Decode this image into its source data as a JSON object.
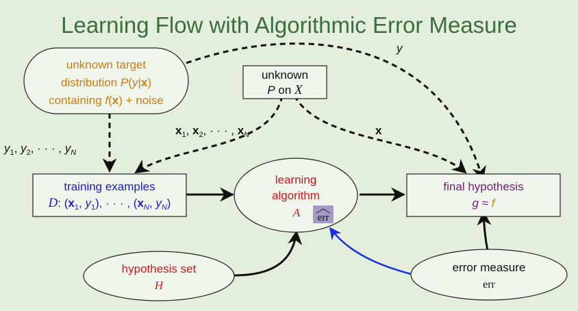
{
  "title": "Learning Flow with Algorithmic Error Measure",
  "colors": {
    "title": "#3c6e3c",
    "orange": "#d07a10",
    "blue": "#1a1ad0",
    "red": "#d01818",
    "purple": "#7a1a7a",
    "err_box": "#a59ac6",
    "blue_arrow": "#1a2ee0"
  },
  "target": {
    "line1": "unknown target",
    "line2_prefix": "distribution ",
    "line2_math": "P(y|x)",
    "line3_math": "f(x)",
    "line3_prefix": "containing ",
    "line3_suffix": " + noise"
  },
  "input_dist": {
    "line1": "unknown",
    "line2_prefix": "P",
    "line2_mid": " on ",
    "line2_sym": "X"
  },
  "training": {
    "line1": "training examples",
    "line2": "D: (x1, y1), · · · , (xN, yN)"
  },
  "algorithm": {
    "line1": "learning",
    "line2": "algorithm",
    "symbol": "A",
    "err_hat": "err"
  },
  "final": {
    "line1": "final hypothesis",
    "g": "g",
    "approx": " ≈ ",
    "f": "f"
  },
  "hypothesis": {
    "line1": "hypothesis set",
    "symbol": "H"
  },
  "error": {
    "line1": "error measure",
    "line2": "err"
  },
  "edge_labels": {
    "y": "y",
    "x": "x",
    "ys": "y1, y2, · · · , yN",
    "xs": "x1, x2, · · · , xN"
  }
}
